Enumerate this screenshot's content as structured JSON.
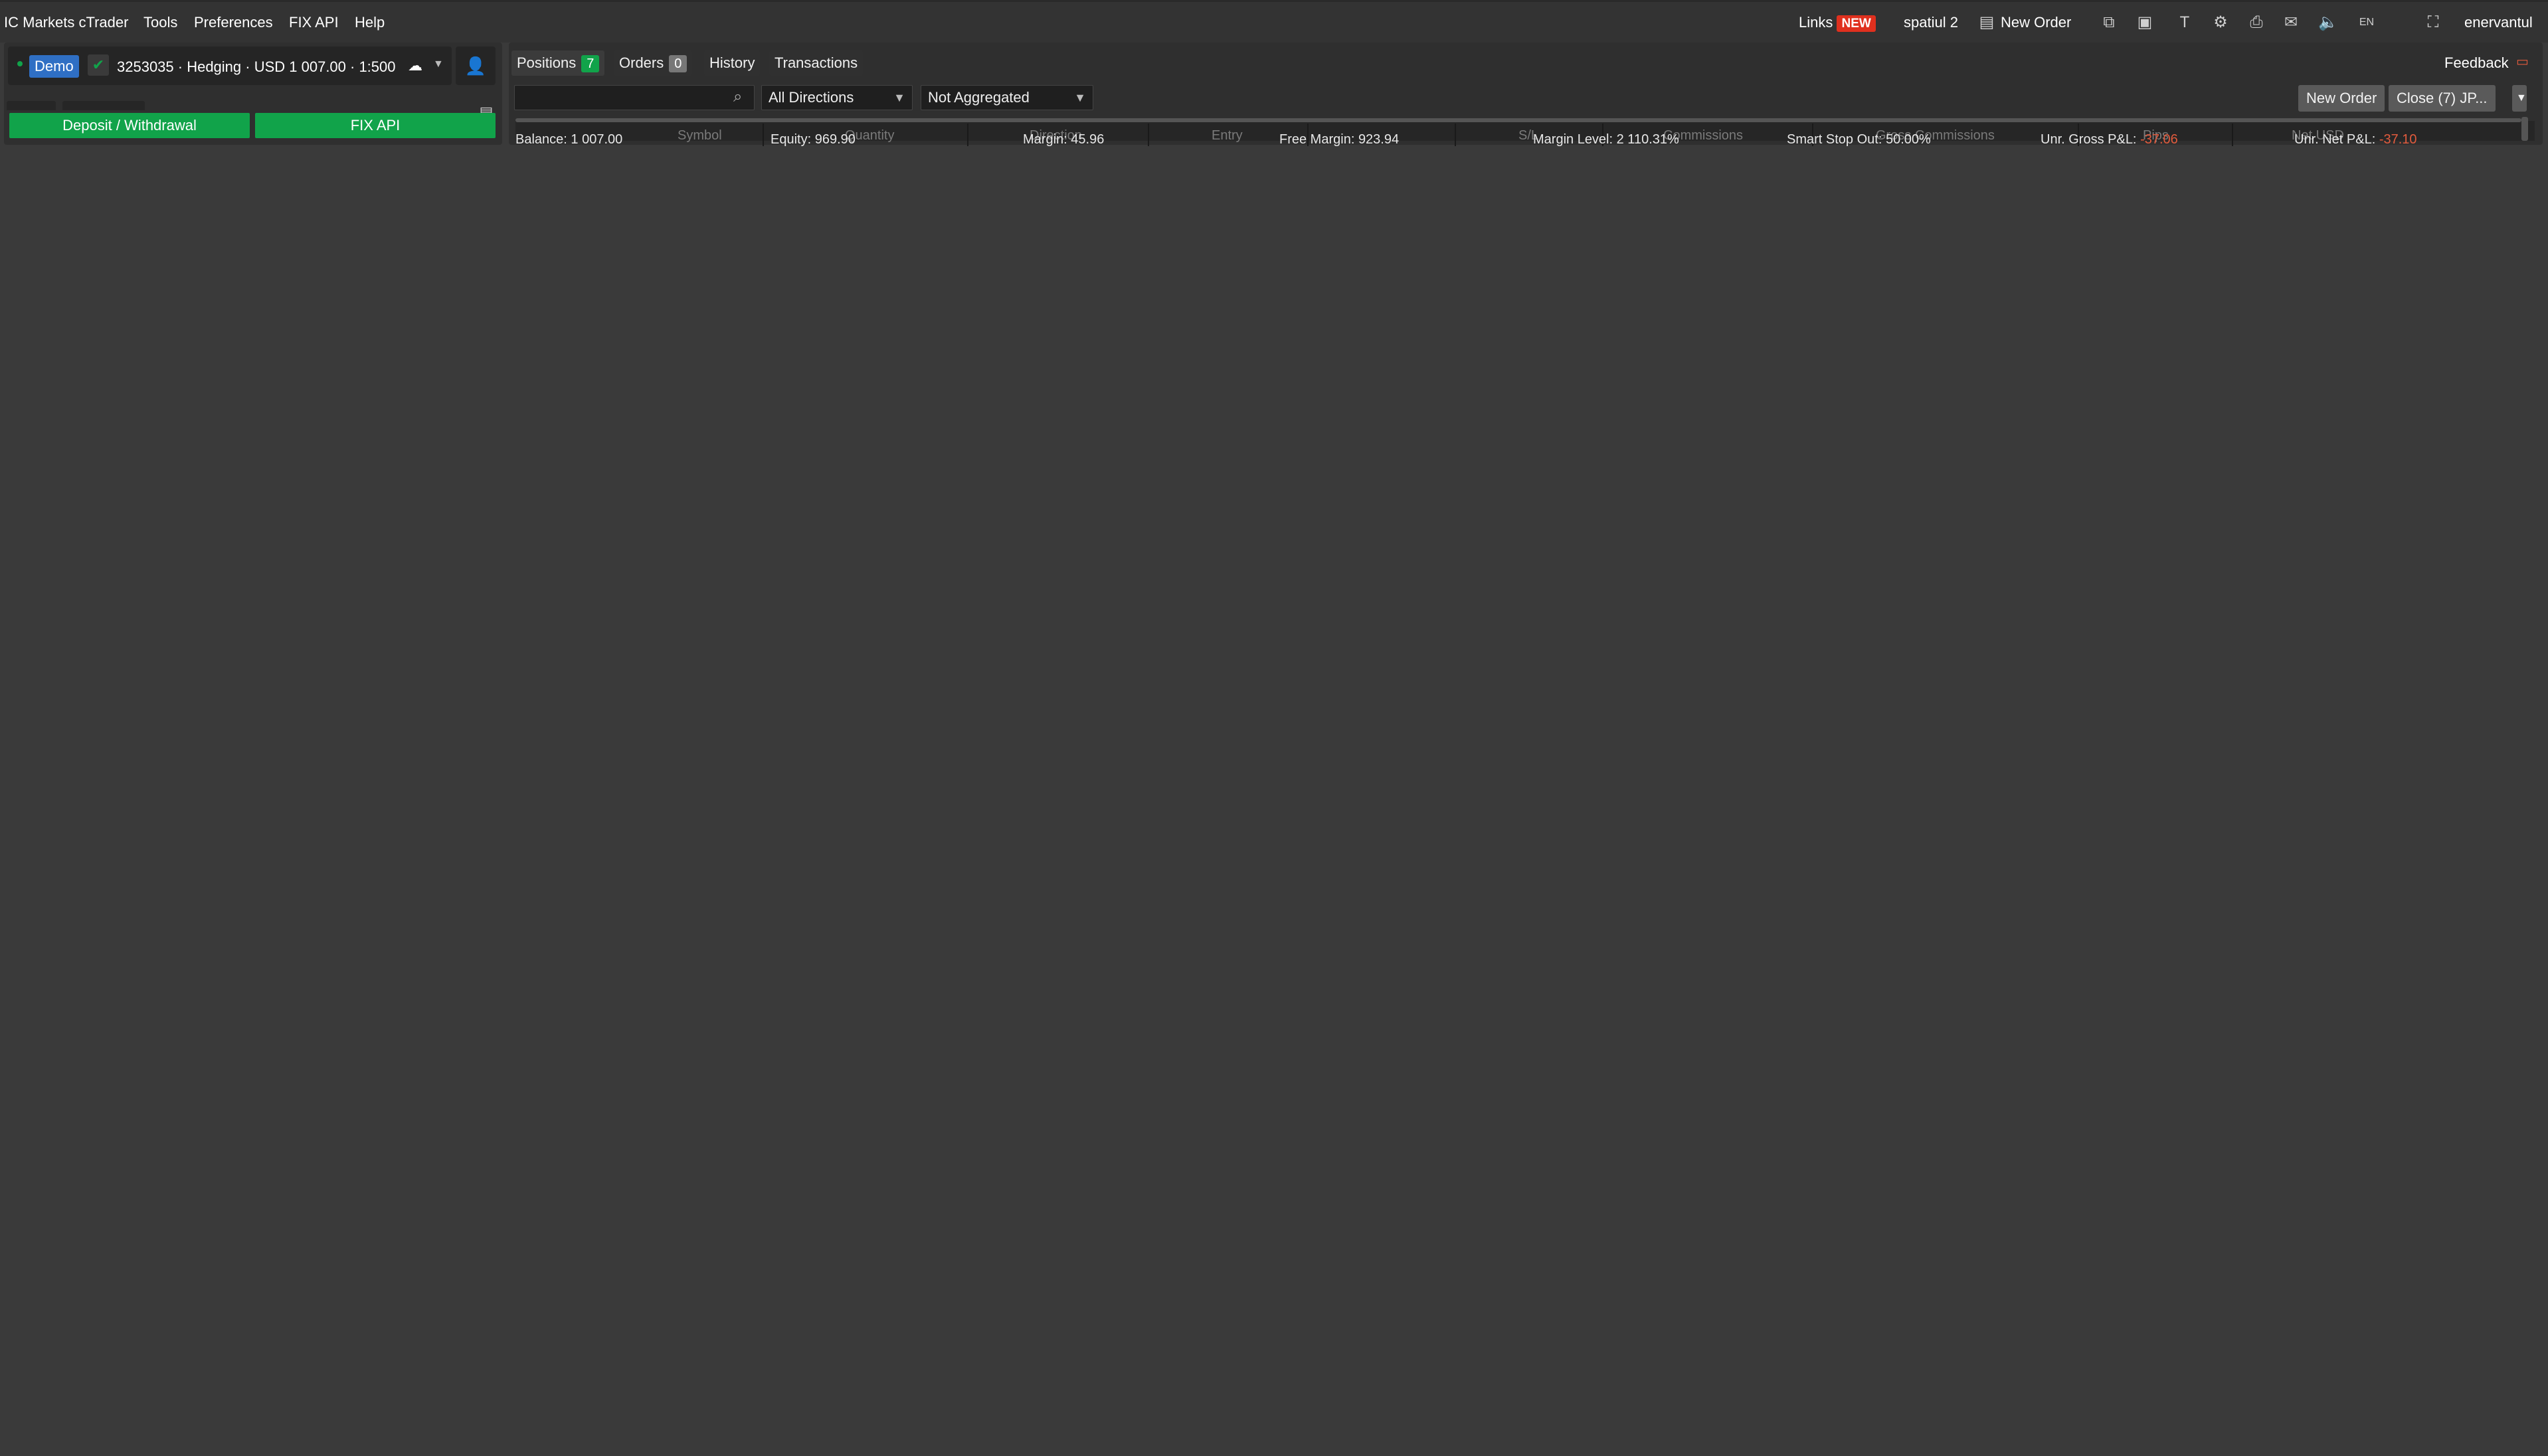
{
  "menubar": {
    "app_title": "IC Markets cTrader",
    "items": [
      "Tools",
      "Preferences",
      "FIX API",
      "Help"
    ],
    "links_label": "Links",
    "new_badge": "NEW",
    "workspace": "spatiul 2",
    "new_order": "New Order",
    "username": "enervantul",
    "lang": "EN"
  },
  "account": {
    "demo": "Demo",
    "summary": "3253035 · Hedging · USD 1 007.00 · 1:500",
    "deposit_button": "Deposit / Withdrawal",
    "fix_button": "FIX API"
  },
  "positions": {
    "tabs": [
      {
        "label": "Positions",
        "count": "7"
      },
      {
        "label": "Orders",
        "count": "0"
      },
      {
        "label": "History"
      },
      {
        "label": "Transactions"
      }
    ],
    "feedback": "Feedback",
    "search_value": "",
    "direction_filter": "All Directions",
    "aggregation": "Not Aggregated",
    "new_order_button": "New Order",
    "close_button": "Close (7) JP...",
    "columns": [
      "Symbol",
      "Quantity",
      "Direction",
      "Entry",
      "S/L",
      "Commissions",
      "Gross Commissions",
      "Pips",
      "Net USD"
    ],
    "summary": {
      "balance_label": "Balance:",
      "balance": "1 007.00",
      "equity_label": "Equity:",
      "equity": "969.90",
      "margin_label": "Margin:",
      "margin": "45.96",
      "free_margin_label": "Free Margin:",
      "free_margin": "923.94",
      "margin_level_label": "Margin Level:",
      "margin_level": "2 110.31%",
      "smart_stop_label": "Smart Stop Out:",
      "smart_stop": "50.00%",
      "unr_gross_label": "Unr. Gross P&L:",
      "unr_gross": "-37.06",
      "unr_net_label": "Unr. Net P&L:",
      "unr_net": "-37.10"
    }
  }
}
